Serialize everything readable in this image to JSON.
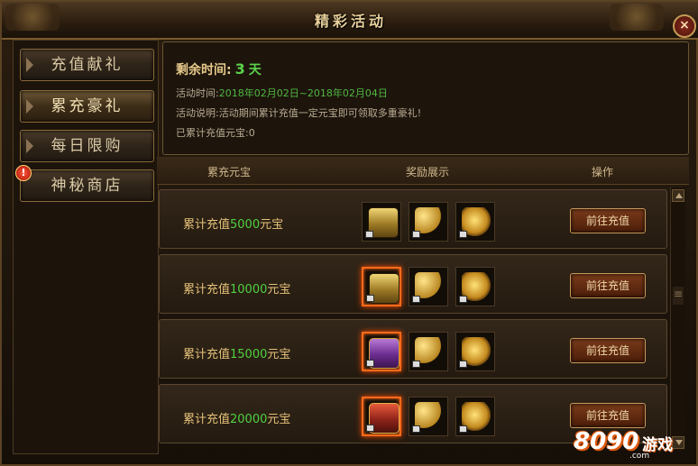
{
  "window": {
    "title": "精彩活动",
    "close_symbol": "×"
  },
  "sidebar": {
    "tabs": [
      {
        "label": "充值献礼",
        "active": false
      },
      {
        "label": "累充豪礼",
        "active": true
      },
      {
        "label": "每日限购",
        "active": false
      },
      {
        "label": "神秘商店",
        "active": false,
        "badge": "!"
      }
    ]
  },
  "info": {
    "remain_label": "剩余时间:",
    "remain_value": "3",
    "remain_unit": "天",
    "time_label": "活动时间:",
    "time_value": "2018年02月02日~2018年02月04日",
    "desc_label": "活动说明:",
    "desc_value": "活动期间累计充值一定元宝即可领取多重豪礼!",
    "total_label": "已累计充值元宝:",
    "total_value": "0"
  },
  "table": {
    "headers": [
      "累充元宝",
      "奖励展示",
      "操作"
    ],
    "rows": [
      {
        "prefix": "累计充值",
        "amount": "5000",
        "suffix": "元宝",
        "button": "前往充值",
        "items": [
          "gold-chest-icon",
          "golden-key-icon",
          "gold-ingot-icon"
        ],
        "highlight": false
      },
      {
        "prefix": "累计充值",
        "amount": "10000",
        "suffix": "元宝",
        "button": "前往充值",
        "items": [
          "gold-chest-icon",
          "golden-key-icon",
          "gold-ingot-icon"
        ],
        "highlight": true
      },
      {
        "prefix": "累计充值",
        "amount": "15000",
        "suffix": "元宝",
        "button": "前往充值",
        "items": [
          "purple-chest-icon",
          "golden-key-icon",
          "gold-ingot-icon"
        ],
        "highlight": true
      },
      {
        "prefix": "累计充值",
        "amount": "20000",
        "suffix": "元宝",
        "button": "前往充值",
        "items": [
          "red-chest-icon",
          "golden-key-icon",
          "gold-ingot-icon"
        ],
        "highlight": true
      }
    ]
  },
  "watermark": {
    "number": "8090",
    "text": "游戏",
    "domain": ".com"
  },
  "colors": {
    "accent_green": "#4fd13f",
    "gold_text": "#e5c27a",
    "glow": "#ff6a1a"
  }
}
